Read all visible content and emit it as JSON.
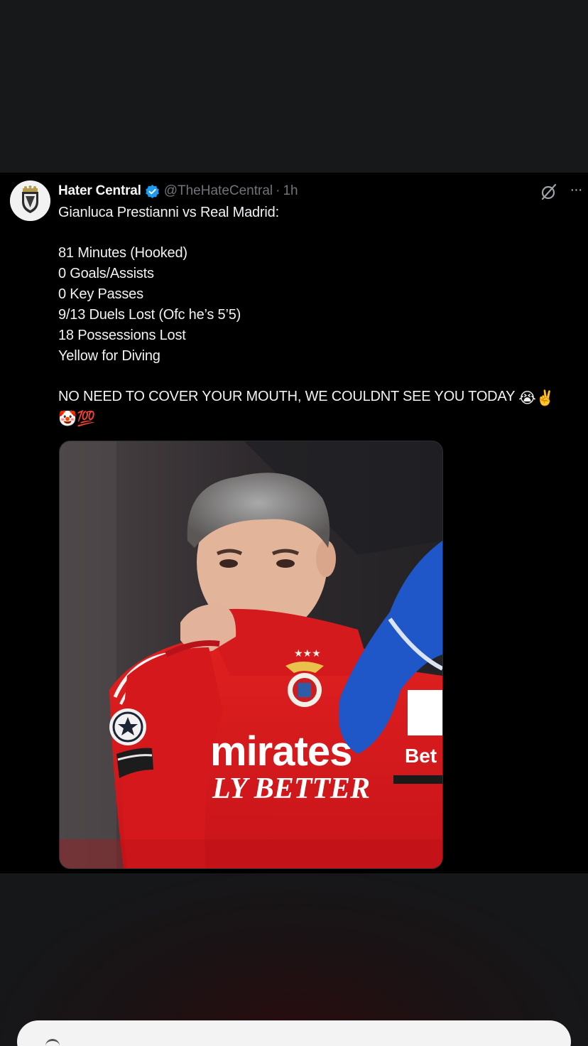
{
  "tweet": {
    "display_name": "Hater Central",
    "handle": "@TheHateCentral",
    "separator": "·",
    "time": "1h",
    "lines": [
      "Gianluca Prestianni vs Real Madrid:",
      "81 Minutes (Hooked)",
      "0 Goals/Assists",
      "0 Key Passes",
      "9/13 Duels Lost (Ofc he’s 5’5)",
      "18 Possessions Lost",
      "Yellow for Diving",
      "NO NEED TO COVER YOUR MOUTH, WE COULDNT SEE YOU TODAY"
    ],
    "emoji_line1": "😭✌️",
    "emoji_line2": "🤡💯",
    "more_label": "···"
  },
  "media": {
    "shirt_sponsor_top": "mirates",
    "shirt_sponsor_bottom": "LY BETTER",
    "sleeve_text": "Bet"
  },
  "icons": {
    "verified": "verified-badge-icon",
    "grok": "grok-icon",
    "more": "more-options-icon"
  },
  "colors": {
    "background": "#000000",
    "text": "#f1f2f3",
    "muted": "#6f7479",
    "verified": "#1d9bf0"
  }
}
